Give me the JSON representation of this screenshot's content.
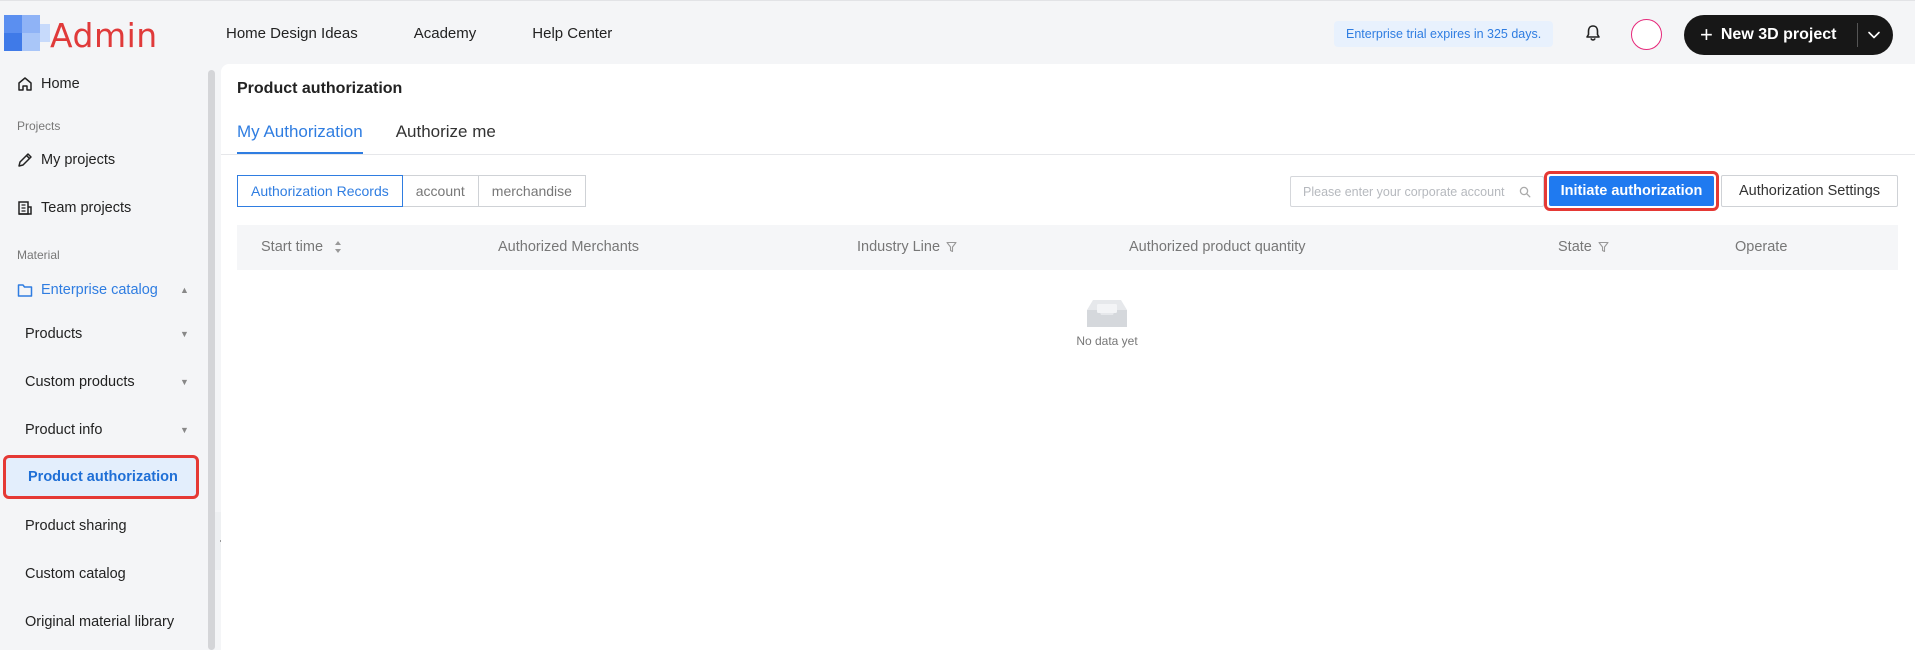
{
  "logo": {
    "text": "Admin"
  },
  "topnav": [
    {
      "label": "Home Design Ideas"
    },
    {
      "label": "Academy"
    },
    {
      "label": "Help Center"
    }
  ],
  "trial_banner": "Enterprise trial expires in 325 days.",
  "new_project_label": "New 3D project",
  "icons": {
    "notifications": "bell-icon",
    "new_project": "plus-icon",
    "new_project_menu": "chevron-down-icon",
    "search": "search-icon",
    "collapse": "caret-left-icon",
    "empty": "empty-box-icon",
    "sort": "sort-icon",
    "filter": "filter-icon"
  },
  "colors": {
    "accent": "#2f7de1",
    "primary_button": "#1f7af0",
    "highlight_outline": "#e53935",
    "dark_button": "#171717",
    "avatar_ring": "#e6287a"
  },
  "sidebar": {
    "home": "Home",
    "group_projects": "Projects",
    "my_projects": "My projects",
    "team_projects": "Team projects",
    "group_material": "Material",
    "enterprise_catalog": "Enterprise catalog",
    "items": [
      {
        "label": "Products",
        "expandable": true
      },
      {
        "label": "Custom products",
        "expandable": true
      },
      {
        "label": "Product info",
        "expandable": true
      },
      {
        "label": "Product authorization",
        "expandable": false,
        "selected": true
      },
      {
        "label": "Product sharing",
        "expandable": false
      },
      {
        "label": "Custom catalog",
        "expandable": false
      },
      {
        "label": "Original material library",
        "expandable": false
      }
    ]
  },
  "main": {
    "title": "Product authorization",
    "tabs": [
      {
        "label": "My Authorization",
        "active": true
      },
      {
        "label": "Authorize me",
        "active": false
      }
    ],
    "segments": [
      {
        "label": "Authorization Records",
        "active": true
      },
      {
        "label": "account",
        "active": false
      },
      {
        "label": "merchandise",
        "active": false
      }
    ],
    "search_placeholder": "Please enter your corporate account",
    "initiate_label": "Initiate authorization",
    "settings_label": "Authorization Settings",
    "columns": [
      {
        "label": "Start time",
        "sortable": true,
        "filterable": false
      },
      {
        "label": "Authorized Merchants",
        "sortable": false,
        "filterable": false
      },
      {
        "label": "Industry Line",
        "sortable": false,
        "filterable": true
      },
      {
        "label": "Authorized product quantity",
        "sortable": false,
        "filterable": false
      },
      {
        "label": "State",
        "sortable": false,
        "filterable": true
      },
      {
        "label": "Operate",
        "sortable": false,
        "filterable": false
      }
    ],
    "empty_text": "No data yet"
  }
}
